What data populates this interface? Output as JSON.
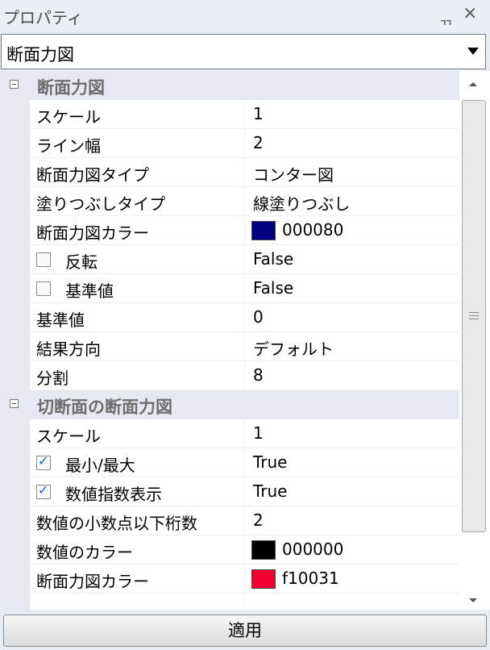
{
  "header": {
    "title": "プロパティ",
    "pin_glyph": "ㅁ",
    "close_glyph": "×"
  },
  "selector": {
    "value": "断面力図"
  },
  "categories": [
    {
      "label": "断面力図",
      "props": [
        {
          "name": "スケール",
          "value": "1"
        },
        {
          "name": "ライン幅",
          "value": "2"
        },
        {
          "name": "断面力図タイプ",
          "value": "コンター図"
        },
        {
          "name": "塗りつぶしタイプ",
          "value": "線塗りつぶし"
        },
        {
          "name": "断面力図カラー",
          "value": "000080",
          "color": "#000080"
        },
        {
          "name": "反転",
          "value": "False",
          "checkbox": false
        },
        {
          "name": "基準値",
          "value": "False",
          "checkbox": false
        },
        {
          "name": "基準値",
          "value": "0"
        },
        {
          "name": "結果方向",
          "value": "デフォルト"
        },
        {
          "name": "分割",
          "value": "8"
        }
      ]
    },
    {
      "label": "切断面の断面力図",
      "props": [
        {
          "name": "スケール",
          "value": "1"
        },
        {
          "name": "最小/最大",
          "value": "True",
          "checkbox": true
        },
        {
          "name": "数値指数表示",
          "value": "True",
          "checkbox": true
        },
        {
          "name": "数値の小数点以下桁数",
          "value": "2"
        },
        {
          "name": "数値のカラー",
          "value": "000000",
          "color": "#000000"
        },
        {
          "name": "断面力図カラー",
          "value": "f10031",
          "color": "#f10031"
        }
      ]
    }
  ],
  "apply_label": "適用"
}
